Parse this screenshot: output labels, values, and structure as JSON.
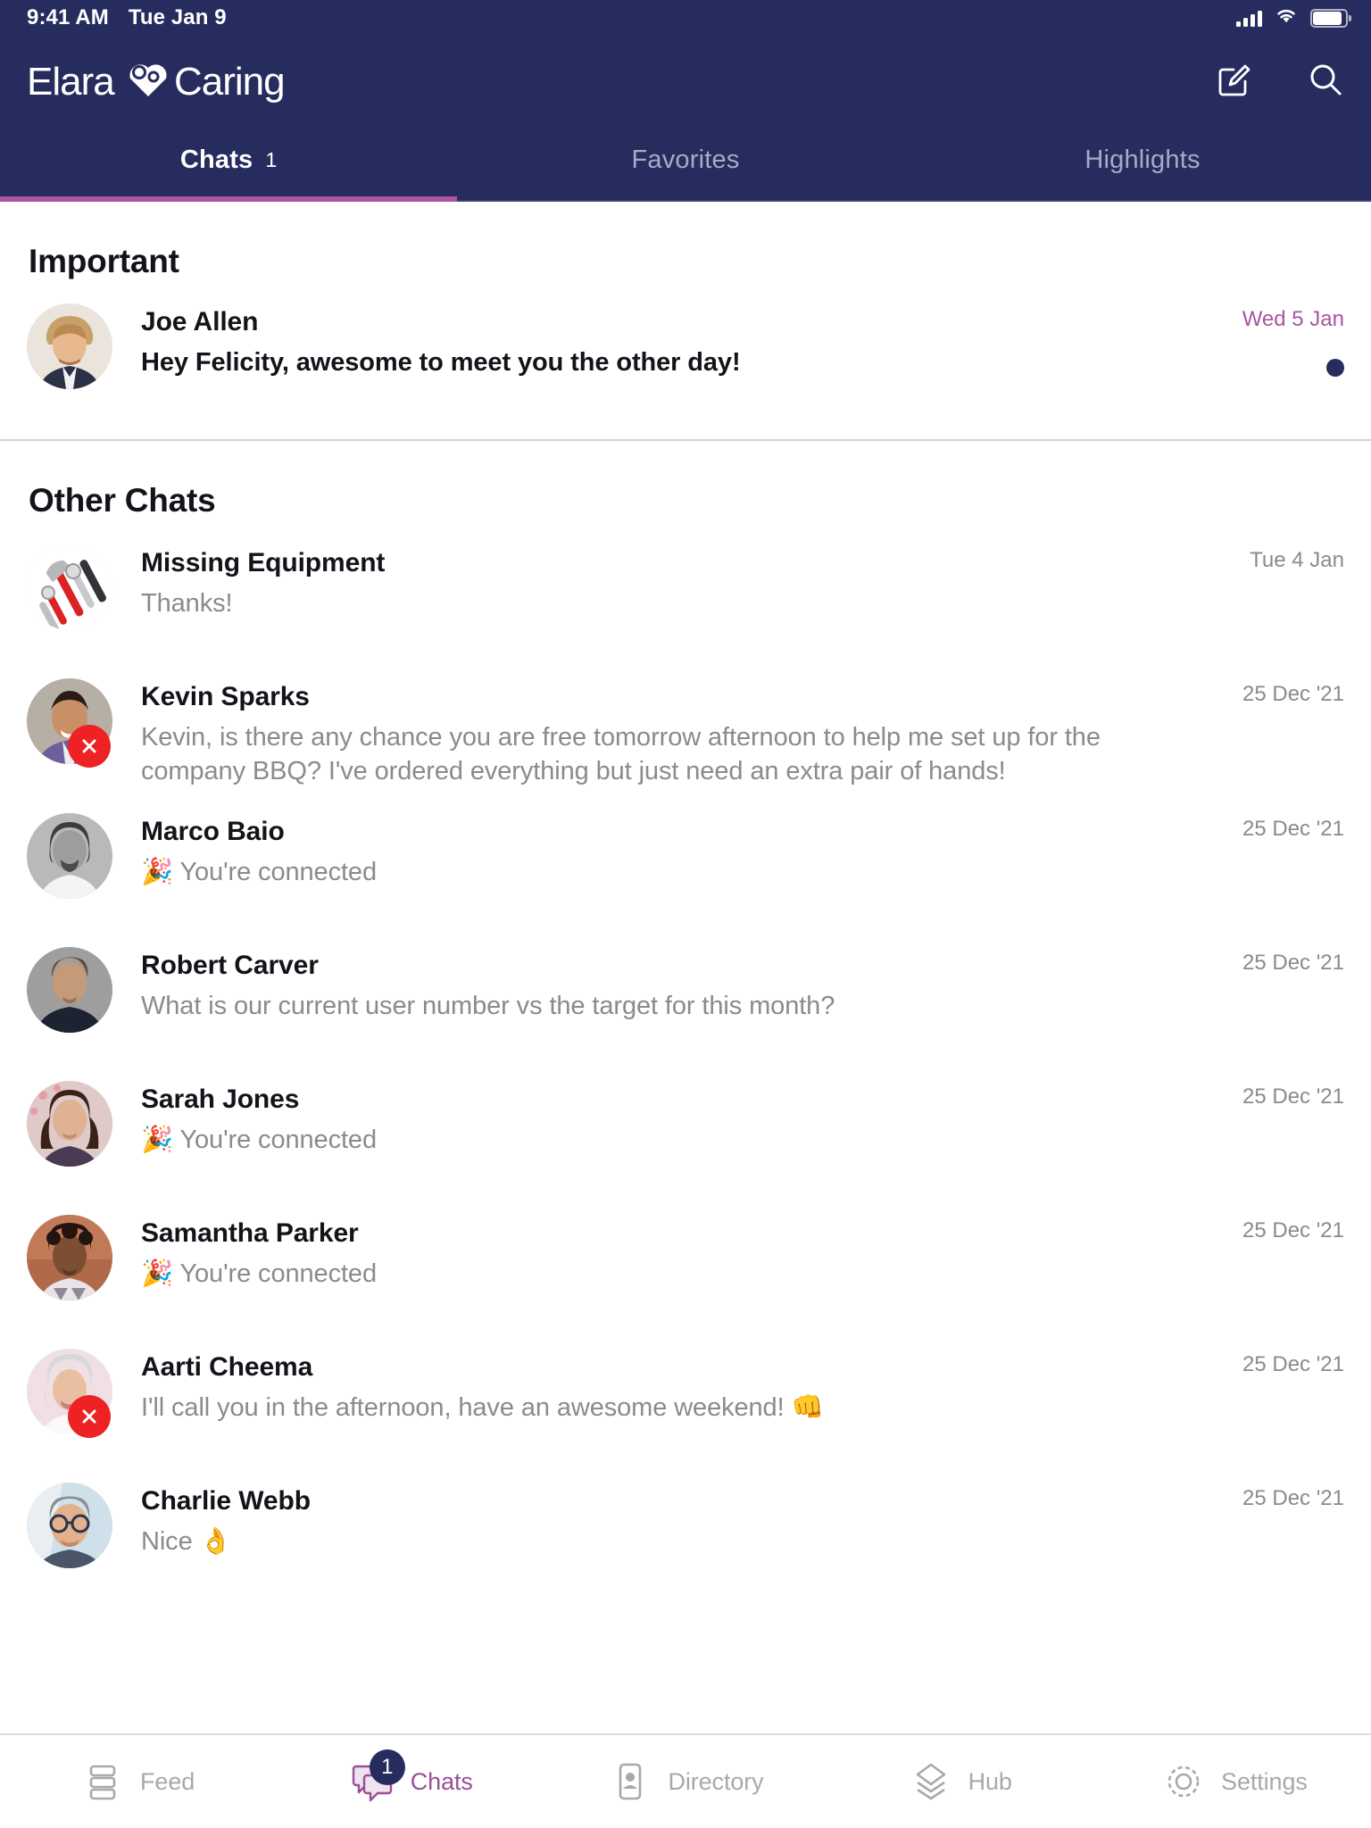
{
  "status_bar": {
    "time": "9:41 AM",
    "date": "Tue Jan 9",
    "signal_icon": "signal-bars-icon",
    "wifi_icon": "wifi-icon",
    "battery_icon": "battery-icon"
  },
  "header": {
    "brand_primary": "Elara",
    "brand_secondary": "Caring",
    "logo_icon": "elara-caring-heart-logo",
    "compose_icon": "compose-icon",
    "search_icon": "search-icon",
    "background_color": "#262c5e"
  },
  "tabs": {
    "accent_color": "#a855a0",
    "items": [
      {
        "label": "Chats",
        "count": "1",
        "active": true
      },
      {
        "label": "Favorites",
        "count": "",
        "active": false
      },
      {
        "label": "Highlights",
        "count": "",
        "active": false
      }
    ]
  },
  "sections": [
    {
      "title": "Important",
      "rows": [
        {
          "name": "Joe Allen",
          "preview": "Hey Felicity, awesome to meet you the other day!",
          "preview_emphasis": true,
          "time": "Wed 5 Jan",
          "time_accent": true,
          "unread": true,
          "error": false,
          "avatar": "joe-allen-avatar"
        }
      ]
    },
    {
      "title": "Other Chats",
      "rows": [
        {
          "name": "Missing Equipment",
          "preview": "Thanks!",
          "preview_emphasis": false,
          "time": "Tue 4 Jan",
          "time_accent": false,
          "unread": false,
          "error": false,
          "avatar": "missing-equipment-tools-avatar"
        },
        {
          "name": "Kevin Sparks",
          "preview": "Kevin, is there any chance you are free tomorrow afternoon to help me set up for the company BBQ? I've ordered everything but just need an extra pair of hands!",
          "preview_emphasis": false,
          "time": "25 Dec '21",
          "time_accent": false,
          "unread": false,
          "error": true,
          "avatar": "kevin-sparks-avatar"
        },
        {
          "name": "Marco Baio",
          "preview": "🎉 You're connected",
          "preview_emphasis": false,
          "time": "25 Dec '21",
          "time_accent": false,
          "unread": false,
          "error": false,
          "avatar": "marco-baio-avatar"
        },
        {
          "name": "Robert Carver",
          "preview": "What is our current user number vs the target for this month?",
          "preview_emphasis": false,
          "time": "25 Dec '21",
          "time_accent": false,
          "unread": false,
          "error": false,
          "avatar": "robert-carver-avatar"
        },
        {
          "name": "Sarah Jones",
          "preview": "🎉 You're connected",
          "preview_emphasis": false,
          "time": "25 Dec '21",
          "time_accent": false,
          "unread": false,
          "error": false,
          "avatar": "sarah-jones-avatar"
        },
        {
          "name": "Samantha Parker",
          "preview": "🎉 You're connected",
          "preview_emphasis": false,
          "time": "25 Dec '21",
          "time_accent": false,
          "unread": false,
          "error": false,
          "avatar": "samantha-parker-avatar"
        },
        {
          "name": "Aarti Cheema",
          "preview": "I'll call you in the afternoon, have an awesome weekend! 👊",
          "preview_emphasis": false,
          "time": "25 Dec '21",
          "time_accent": false,
          "unread": false,
          "error": true,
          "avatar": "aarti-cheema-avatar"
        },
        {
          "name": "Charlie Webb",
          "preview": "Nice 👌",
          "preview_emphasis": false,
          "time": "25 Dec '21",
          "time_accent": false,
          "unread": false,
          "error": false,
          "avatar": "charlie-webb-avatar"
        }
      ]
    }
  ],
  "bottom_nav": {
    "active_color": "#9a4f96",
    "inactive_color": "#a8a8ad",
    "items": [
      {
        "label": "Feed",
        "icon": "feed-icon",
        "active": false,
        "badge": ""
      },
      {
        "label": "Chats",
        "icon": "chats-icon",
        "active": true,
        "badge": "1"
      },
      {
        "label": "Directory",
        "icon": "directory-icon",
        "active": false,
        "badge": ""
      },
      {
        "label": "Hub",
        "icon": "hub-icon",
        "active": false,
        "badge": ""
      },
      {
        "label": "Settings",
        "icon": "settings-gear-icon",
        "active": false,
        "badge": ""
      }
    ]
  }
}
